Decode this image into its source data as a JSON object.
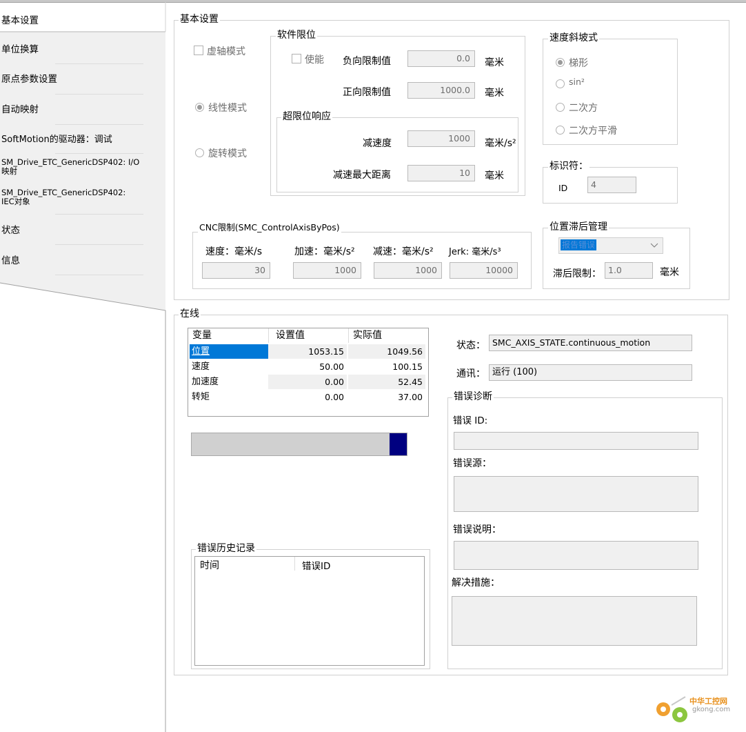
{
  "sidebar": {
    "items": [
      {
        "label": "基本设置"
      },
      {
        "label": "单位换算"
      },
      {
        "label": "原点参数设置"
      },
      {
        "label": "自动映射"
      },
      {
        "label": "SoftMotion的驱动器：调试"
      },
      {
        "label": "SM_Drive_ETC_GenericDSP402: I/O\n映射"
      },
      {
        "label": "SM_Drive_ETC_GenericDSP402:\nIEC对象"
      },
      {
        "label": "状态"
      },
      {
        "label": "信息"
      }
    ]
  },
  "basic": {
    "title": "基本设置",
    "virtual_mode": "虚轴模式",
    "linear_mode": "线性模式",
    "rotary_mode": "旋转模式",
    "soft_limits": {
      "title": "软件限位",
      "enable": "使能",
      "neg_label": "负向限制值",
      "neg_value": "0.0",
      "pos_label": "正向限制值",
      "pos_value": "1000.0",
      "unit": "毫米"
    },
    "overlimit": {
      "title": "超限位响应",
      "decel_label": "减速度",
      "decel_value": "1000",
      "decel_unit": "毫米/s²",
      "maxdist_label": "减速最大距离",
      "maxdist_value": "10",
      "maxdist_unit": "毫米"
    },
    "ramp": {
      "title": "速度斜坡式",
      "options": [
        "梯形",
        "sin²",
        "二次方",
        "二次方平滑"
      ]
    },
    "ident": {
      "title": "标识符：",
      "id_label": "ID",
      "id_value": "4"
    },
    "cnc": {
      "title": "CNC限制(SMC_ControlAxisByPos)",
      "speed_label": "速度：毫米/s",
      "speed_value": "30",
      "acc_label": "加速：毫米/s²",
      "acc_value": "1000",
      "dec_label": "减速：毫米/s²",
      "dec_value": "1000",
      "jerk_label": "Jerk: 毫米/s³",
      "jerk_value": "10000"
    },
    "lag": {
      "title": "位置滞后管理",
      "select_value": "报告错误",
      "limit_label": "滞后限制：",
      "limit_value": "1.0",
      "unit": "毫米"
    }
  },
  "online": {
    "title": "在线",
    "table": {
      "headers": [
        "变量",
        "设置值",
        "实际值"
      ],
      "rows": [
        {
          "name": "位置",
          "set": "1053.15",
          "actual": "1049.56"
        },
        {
          "name": "速度",
          "set": "50.00",
          "actual": "100.15"
        },
        {
          "name": "加速度",
          "set": "0.00",
          "actual": "52.45"
        },
        {
          "name": "转矩",
          "set": "0.00",
          "actual": "37.00"
        }
      ]
    },
    "progress": 0.08,
    "state_label": "状态：",
    "state_value": "SMC_AXIS_STATE.continuous_motion",
    "comm_label": "通讯：",
    "comm_value": "运行 (100)",
    "history": {
      "title": "错误历史记录",
      "col_time": "时间",
      "col_id": "错误ID"
    },
    "diag": {
      "title": "错误诊断",
      "id_label": "错误 ID:",
      "source_label": "错误源：",
      "desc_label": "错误说明：",
      "action_label": "解决措施："
    }
  },
  "watermark": {
    "text": "中华工控网",
    "sub": "gkong.com"
  },
  "colors": {
    "selection": "#0078d7",
    "progress": "#000080",
    "border": "#d0d0d0"
  }
}
